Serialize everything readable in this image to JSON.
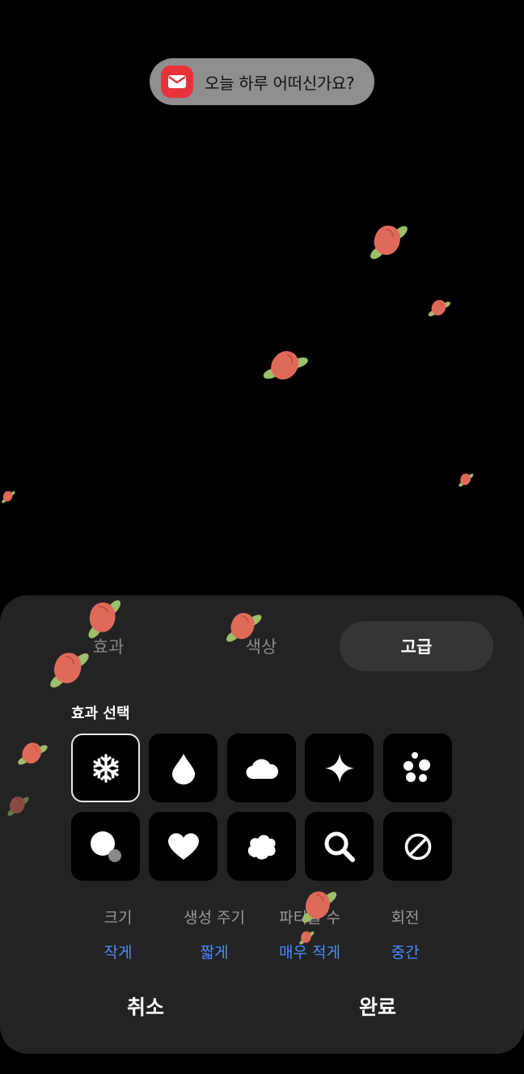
{
  "toast": {
    "text": "오늘 하루 어떠신가요?",
    "icon": "mail-icon"
  },
  "tabs": [
    {
      "label": "효과",
      "selected": false
    },
    {
      "label": "색상",
      "selected": false
    },
    {
      "label": "고급",
      "selected": true
    }
  ],
  "section_title": "효과 선택",
  "effects": [
    {
      "icon": "snowflake-icon",
      "selected": true
    },
    {
      "icon": "drop-icon",
      "selected": false
    },
    {
      "icon": "cloud-icon",
      "selected": false
    },
    {
      "icon": "sparkle-icon",
      "selected": false
    },
    {
      "icon": "bubbles-icon",
      "selected": false
    },
    {
      "icon": "circles-icon",
      "selected": false
    },
    {
      "icon": "heart-icon",
      "selected": false
    },
    {
      "icon": "blob-icon",
      "selected": false
    },
    {
      "icon": "magnifier-icon",
      "selected": false
    },
    {
      "icon": "none-icon",
      "selected": false
    }
  ],
  "options": [
    {
      "label": "크기",
      "value": "작게"
    },
    {
      "label": "생성 주기",
      "value": "짧게"
    },
    {
      "label": "파티클 수",
      "value": "매우 적게"
    },
    {
      "label": "회전",
      "value": "중간"
    }
  ],
  "buttons": {
    "cancel": "취소",
    "done": "완료"
  },
  "colors": {
    "accent": "#4a8dff",
    "sheet": "#232323",
    "petal": "#e06a5a",
    "leaf": "#9cbf6a"
  }
}
